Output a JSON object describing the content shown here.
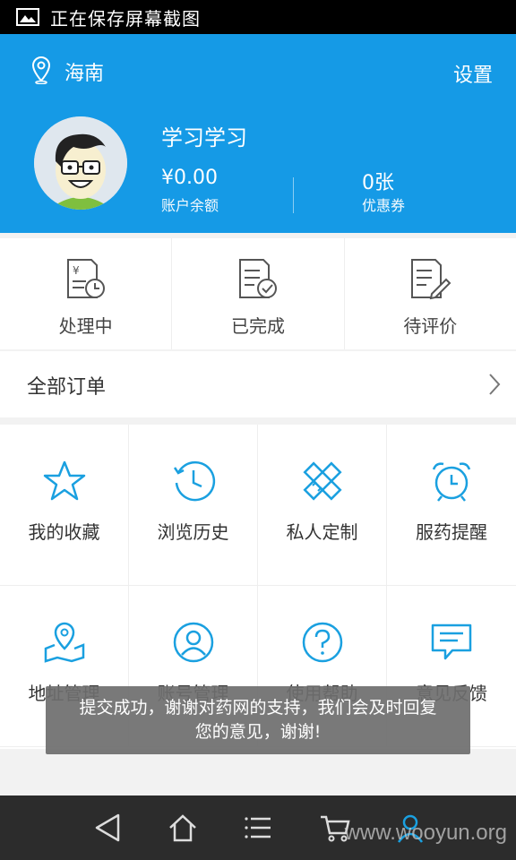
{
  "status_bar": {
    "text": "正在保存屏幕截图"
  },
  "header": {
    "location": "海南",
    "settings_label": "设置",
    "username": "学习学习",
    "balance_value": "¥0.00",
    "balance_label": "账户余额",
    "coupon_value": "0张",
    "coupon_label": "优惠券"
  },
  "orders": {
    "items": [
      {
        "label": "处理中",
        "icon": "processing-order-icon"
      },
      {
        "label": "已完成",
        "icon": "completed-order-icon"
      },
      {
        "label": "待评价",
        "icon": "pending-review-icon"
      }
    ],
    "all_orders_label": "全部订单"
  },
  "grid": {
    "items": [
      {
        "label": "我的收藏",
        "icon": "star-icon"
      },
      {
        "label": "浏览历史",
        "icon": "history-icon"
      },
      {
        "label": "私人定制",
        "icon": "pencil-ruler-icon"
      },
      {
        "label": "服药提醒",
        "icon": "alarm-clock-icon"
      },
      {
        "label": "地址管理",
        "icon": "map-pin-icon"
      },
      {
        "label": "账号管理",
        "icon": "user-icon"
      },
      {
        "label": "使用帮助",
        "icon": "question-icon"
      },
      {
        "label": "意见反馈",
        "icon": "feedback-icon"
      }
    ]
  },
  "toast": {
    "text": "提交成功，谢谢对药网的支持，我们会及时回复您的意见，谢谢!"
  },
  "watermark": "www.wooyun.org",
  "colors": {
    "primary": "#159ae6",
    "icon": "#1aa0e0",
    "text": "#333333",
    "navbar": "#2c2c2c"
  }
}
